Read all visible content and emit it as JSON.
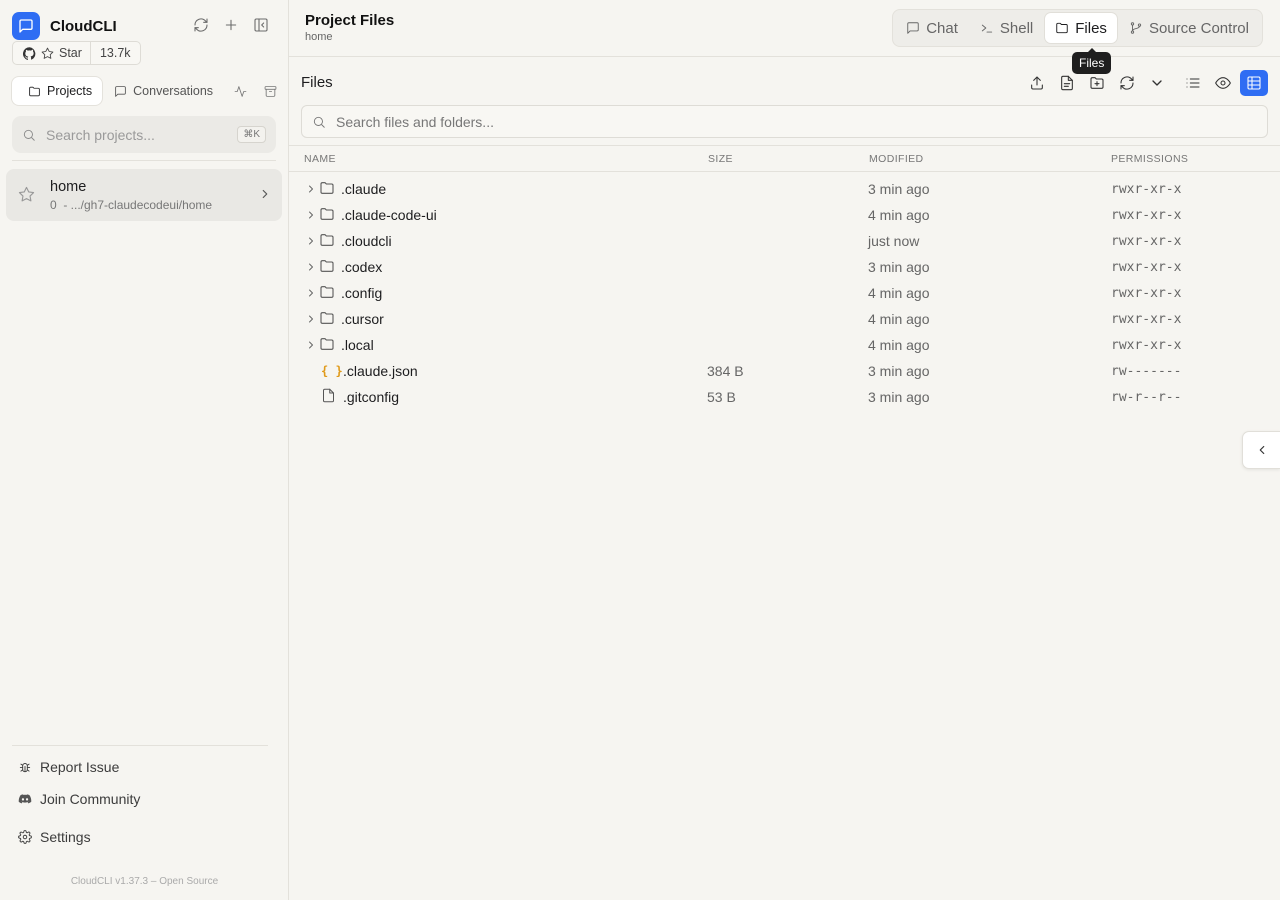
{
  "sidebar": {
    "brand": "CloudCLI",
    "github": {
      "star_label": "Star",
      "star_count": "13.7k"
    },
    "tabs": [
      {
        "label": "Projects"
      },
      {
        "label": "Conversations"
      }
    ],
    "search": {
      "placeholder": "Search projects...",
      "shortcut": "⌘K"
    },
    "project": {
      "name": "home",
      "subtitle": "0  - .../gh7-claudecodeui/home"
    },
    "footer": {
      "report": "Report Issue",
      "community": "Join Community",
      "settings": "Settings",
      "version": "CloudCLI v1.37.3 – Open Source"
    }
  },
  "header": {
    "title": "Project Files",
    "subtitle": "home",
    "tabs": [
      {
        "label": "Chat"
      },
      {
        "label": "Shell"
      },
      {
        "label": "Files"
      },
      {
        "label": "Source Control"
      }
    ],
    "tooltip": "Files"
  },
  "files": {
    "label": "Files",
    "search_placeholder": "Search files and folders...",
    "columns": {
      "name": "NAME",
      "size": "SIZE",
      "modified": "MODIFIED",
      "permissions": "PERMISSIONS"
    },
    "rows": [
      {
        "name": ".claude",
        "size": "",
        "modified": "3 min ago",
        "permissions": "rwxr-xr-x",
        "type": "folder"
      },
      {
        "name": ".claude-code-ui",
        "size": "",
        "modified": "4 min ago",
        "permissions": "rwxr-xr-x",
        "type": "folder"
      },
      {
        "name": ".cloudcli",
        "size": "",
        "modified": "just now",
        "permissions": "rwxr-xr-x",
        "type": "folder"
      },
      {
        "name": ".codex",
        "size": "",
        "modified": "3 min ago",
        "permissions": "rwxr-xr-x",
        "type": "folder"
      },
      {
        "name": ".config",
        "size": "",
        "modified": "4 min ago",
        "permissions": "rwxr-xr-x",
        "type": "folder"
      },
      {
        "name": ".cursor",
        "size": "",
        "modified": "4 min ago",
        "permissions": "rwxr-xr-x",
        "type": "folder"
      },
      {
        "name": ".local",
        "size": "",
        "modified": "4 min ago",
        "permissions": "rwxr-xr-x",
        "type": "folder"
      },
      {
        "name": ".claude.json",
        "size": "384 B",
        "modified": "3 min ago",
        "permissions": "rw-------",
        "type": "json"
      },
      {
        "name": ".gitconfig",
        "size": "53 B",
        "modified": "3 min ago",
        "permissions": "rw-r--r--",
        "type": "file"
      }
    ]
  },
  "colors": {
    "accent": "#2f6df3",
    "json_icon": "#e09a1a"
  }
}
